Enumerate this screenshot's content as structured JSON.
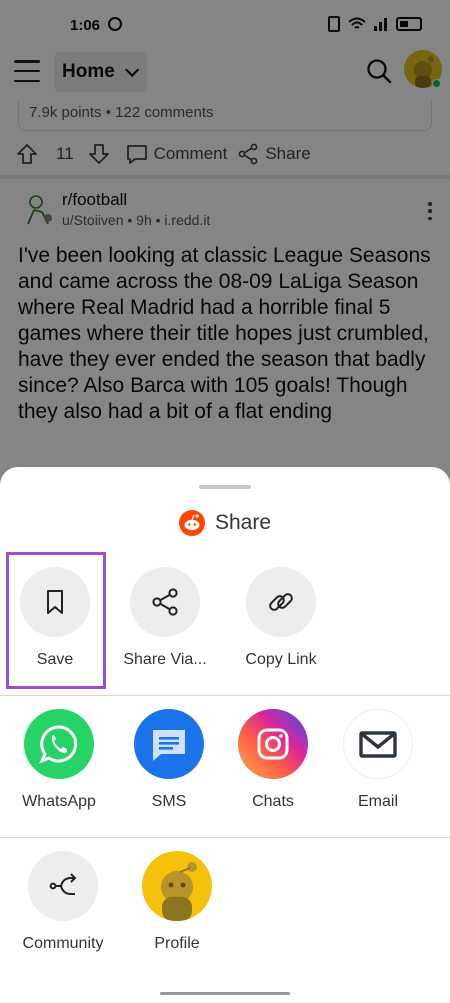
{
  "status_bar": {
    "time": "1:06"
  },
  "top_bar": {
    "home_label": "Home"
  },
  "previous_post": {
    "meta": "7.9k points • 122 comments",
    "upvotes": "11",
    "comment_label": "Comment",
    "share_label": "Share"
  },
  "post": {
    "subreddit": "r/football",
    "meta": "u/Stoiiven • 9h • i.redd.it",
    "title": "I've been looking at classic League Seasons and came across the 08-09 LaLiga Season where Real Madrid had a horrible final 5 games where their title hopes just crumbled, have they ever ended the season that badly since? Also Barca with 105 goals! Though they also had a bit of a flat ending"
  },
  "share_sheet": {
    "title": "Share",
    "row1": [
      {
        "label": "Save",
        "icon": "bookmark-icon"
      },
      {
        "label": "Share Via...",
        "icon": "share-icon"
      },
      {
        "label": "Copy Link",
        "icon": "link-icon"
      }
    ],
    "row2": [
      {
        "label": "WhatsApp",
        "icon": "whatsapp-icon",
        "color": "#25d366"
      },
      {
        "label": "SMS",
        "icon": "sms-icon",
        "color": "#1a73e8"
      },
      {
        "label": "Chats",
        "icon": "instagram-icon",
        "color": "#d6249f"
      },
      {
        "label": "Email",
        "icon": "email-icon",
        "color": "#2d3640"
      }
    ],
    "row3": [
      {
        "label": "Community",
        "icon": "crosspost-icon"
      },
      {
        "label": "Profile",
        "icon": "profile-avatar-icon",
        "color": "#f4c20d"
      }
    ]
  },
  "colors": {
    "highlight": "#9a4dd6",
    "reddit": "#ff4500"
  }
}
